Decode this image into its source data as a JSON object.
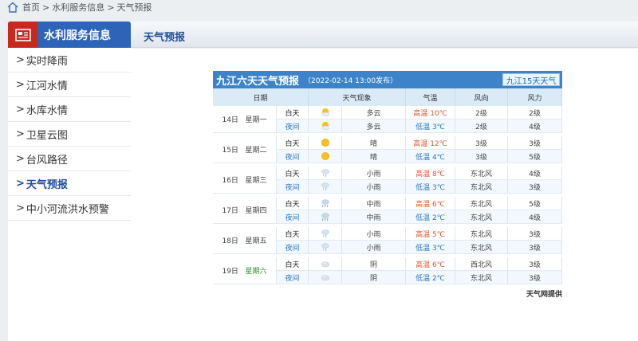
{
  "breadcrumb": {
    "home": "首页",
    "sep1": ">",
    "section": "水利服务信息",
    "sep2": ">",
    "current": "天气预报"
  },
  "sidebar": {
    "title": "水利服务信息",
    "items": [
      {
        "label": "实时降雨",
        "active": false
      },
      {
        "label": "江河水情",
        "active": false
      },
      {
        "label": "水库水情",
        "active": false
      },
      {
        "label": "卫星云图",
        "active": false
      },
      {
        "label": "台风路径",
        "active": false
      },
      {
        "label": "天气预报",
        "active": true
      },
      {
        "label": "中小河流洪水预警",
        "active": false
      }
    ],
    "chevron": ">"
  },
  "main": {
    "tab_label": "天气预报"
  },
  "forecast": {
    "city_title": "九江六天天气预报",
    "published": "（2022-02-14 13:00发布）",
    "btn_15day": "九江15天天气",
    "headers": {
      "date": "日期",
      "phenomenon": "天气现象",
      "temp": "气温",
      "wind_dir": "风向",
      "wind_force": "风力"
    },
    "credit": "天气网提供",
    "colors": {
      "accent": "#3c83c9",
      "high": "#e1552e",
      "low": "#2a77c0",
      "saturday": "#2a8a2a"
    },
    "days": [
      {
        "date": "14日",
        "weekday": "星期一",
        "day": {
          "period": "白天",
          "icon": "partly-cloudy-icon",
          "wx": "多云",
          "temp_label": "高温",
          "temp": "10℃",
          "wind_dir": "2级",
          "wind_force": "2级"
        },
        "night": {
          "period": "夜间",
          "icon": "partly-cloudy-icon",
          "wx": "多云",
          "temp_label": "低温",
          "temp": "3℃",
          "wind_dir": "2级",
          "wind_force": "4级"
        }
      },
      {
        "date": "15日",
        "weekday": "星期二",
        "day": {
          "period": "白天",
          "icon": "sunny-icon",
          "wx": "晴",
          "temp_label": "高温",
          "temp": "12℃",
          "wind_dir": "3级",
          "wind_force": "3级"
        },
        "night": {
          "period": "夜间",
          "icon": "sunny-icon",
          "wx": "晴",
          "temp_label": "低温",
          "temp": "4℃",
          "wind_dir": "3级",
          "wind_force": "5级"
        }
      },
      {
        "date": "16日",
        "weekday": "星期三",
        "day": {
          "period": "白天",
          "icon": "light-rain-icon",
          "wx": "小雨",
          "temp_label": "高温",
          "temp": "8℃",
          "wind_dir": "东北风",
          "wind_force": "4级"
        },
        "night": {
          "period": "夜间",
          "icon": "light-rain-icon",
          "wx": "小雨",
          "temp_label": "低温",
          "temp": "3℃",
          "wind_dir": "东北风",
          "wind_force": "3级"
        }
      },
      {
        "date": "17日",
        "weekday": "星期四",
        "day": {
          "period": "白天",
          "icon": "moderate-rain-icon",
          "wx": "中雨",
          "temp_label": "高温",
          "temp": "6℃",
          "wind_dir": "东北风",
          "wind_force": "5级"
        },
        "night": {
          "period": "夜间",
          "icon": "moderate-rain-icon",
          "wx": "中雨",
          "temp_label": "低温",
          "temp": "2℃",
          "wind_dir": "东北风",
          "wind_force": "4级"
        }
      },
      {
        "date": "18日",
        "weekday": "星期五",
        "day": {
          "period": "白天",
          "icon": "light-rain-icon",
          "wx": "小雨",
          "temp_label": "高温",
          "temp": "5℃",
          "wind_dir": "东北风",
          "wind_force": "3级"
        },
        "night": {
          "period": "夜间",
          "icon": "light-rain-icon",
          "wx": "小雨",
          "temp_label": "低温",
          "temp": "3℃",
          "wind_dir": "东北风",
          "wind_force": "3级"
        }
      },
      {
        "date": "19日",
        "weekday": "星期六",
        "day": {
          "period": "白天",
          "icon": "overcast-icon",
          "wx": "阴",
          "temp_label": "高温",
          "temp": "6℃",
          "wind_dir": "西北风",
          "wind_force": "3级"
        },
        "night": {
          "period": "夜间",
          "icon": "overcast-icon",
          "wx": "阴",
          "temp_label": "低温",
          "temp": "2℃",
          "wind_dir": "东北风",
          "wind_force": "3级"
        }
      }
    ]
  }
}
